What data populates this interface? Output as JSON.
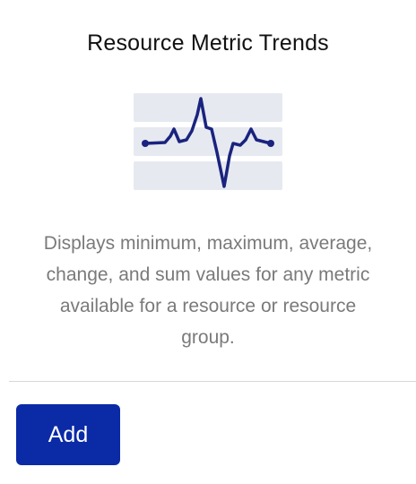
{
  "card": {
    "title": "Resource Metric Trends",
    "description": "Displays minimum, maximum, average, change, and sum values for any metric available for a resource or resource group.",
    "illustration_icon": "line-chart-trend-icon",
    "add_button_label": "Add"
  },
  "colors": {
    "button_background": "#0b2aa6",
    "illustration_line": "#1a237e",
    "illustration_bands": "#e6e9f0",
    "description_text": "#7a7a7a"
  }
}
